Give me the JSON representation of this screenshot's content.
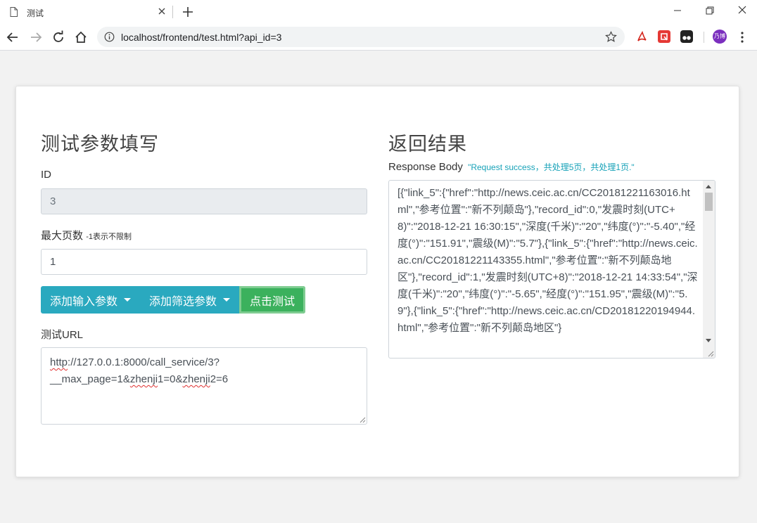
{
  "browser": {
    "tab_title": "测试",
    "url": "localhost/frontend/test.html?api_id=3",
    "avatar_text": "乃博"
  },
  "left": {
    "heading": "测试参数填写",
    "id_label": "ID",
    "id_value": "3",
    "max_page_label": "最大页数",
    "max_page_hint": "-1表示不限制",
    "max_page_value": "1",
    "add_input_param_label": "添加输入参数",
    "add_filter_param_label": "添加筛选参数",
    "test_button_label": "点击测试",
    "test_url_label": "测试URL",
    "test_url_parts": [
      "http",
      "://127.0.0.1:8000/call_service/3?",
      "__max_page=1&",
      "zhenji",
      "1=0&",
      "zhenji",
      "2=6"
    ]
  },
  "right": {
    "heading": "返回结果",
    "response_label": "Response Body",
    "response_status": "\"Request success，共处理5页，共处理1页.\"",
    "response_body": "[{\"link_5\":{\"href\":\"http://news.ceic.ac.cn/CC20181221163016.html\",\"参考位置\":\"新不列颠岛\"},\"record_id\":0,\"发震时刻(UTC+8)\":\"2018-12-21 16:30:15\",\"深度(千米)\":\"20\",\"纬度(°)\":\"-5.40\",\"经度(°)\":\"151.91\",\"震级(M)\":\"5.7\"},{\"link_5\":{\"href\":\"http://news.ceic.ac.cn/CC20181221143355.html\",\"参考位置\":\"新不列颠岛地区\"},\"record_id\":1,\"发震时刻(UTC+8)\":\"2018-12-21 14:33:54\",\"深度(千米)\":\"20\",\"纬度(°)\":\"-5.65\",\"经度(°)\":\"151.95\",\"震级(M)\":\"5.9\"},{\"link_5\":{\"href\":\"http://news.ceic.ac.cn/CD20181220194944.html\",\"参考位置\":\"新不列颠岛地区\"}"
  }
}
